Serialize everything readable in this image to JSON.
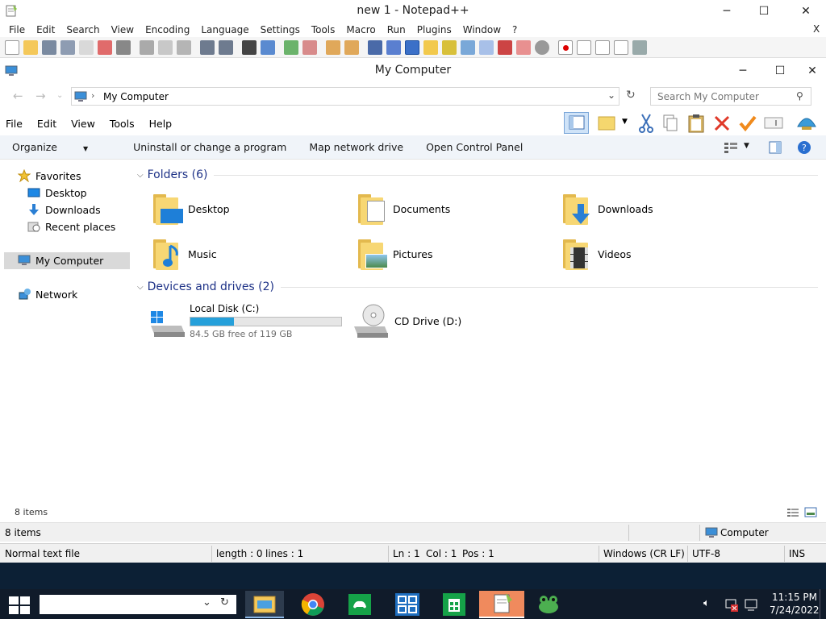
{
  "npp": {
    "title": "new 1 - Notepad++",
    "menu": [
      "File",
      "Edit",
      "Search",
      "View",
      "Encoding",
      "Language",
      "Settings",
      "Tools",
      "Macro",
      "Run",
      "Plugins",
      "Window",
      "?"
    ],
    "menu_close": "X"
  },
  "explorer": {
    "title": "My Computer",
    "address": "My Computer",
    "search_placeholder": "Search My Computer",
    "menu": [
      "File",
      "Edit",
      "View",
      "Tools",
      "Help"
    ],
    "commands": [
      "Organize",
      "Uninstall or change a program",
      "Map network drive",
      "Open Control Panel"
    ],
    "nav": {
      "favorites": "Favorites",
      "desktop": "Desktop",
      "downloads": "Downloads",
      "recent": "Recent places",
      "computer": "My Computer",
      "network": "Network"
    },
    "folders_header": "Folders (6)",
    "folders": [
      "Desktop",
      "Documents",
      "Downloads",
      "Music",
      "Pictures",
      "Videos"
    ],
    "devices_header": "Devices and drives (2)",
    "drives": [
      {
        "name": "Local Disk (C:)",
        "free_text": "84.5 GB free of 119 GB",
        "used_fraction": 0.29
      },
      {
        "name": "CD Drive (D:)"
      }
    ],
    "status_items": "8 items"
  },
  "status": {
    "items": "8 items",
    "location": "Computer"
  },
  "npp_status": {
    "type": "Normal text file",
    "length": "length : 0",
    "lines": "lines : 1",
    "ln": "Ln : 1",
    "col": "Col : 1",
    "pos": "Pos : 1",
    "eol": "Windows (CR LF)",
    "encoding": "UTF-8",
    "mode": "INS"
  },
  "taskbar": {
    "time": "11:15 PM",
    "date": "7/24/2022"
  }
}
